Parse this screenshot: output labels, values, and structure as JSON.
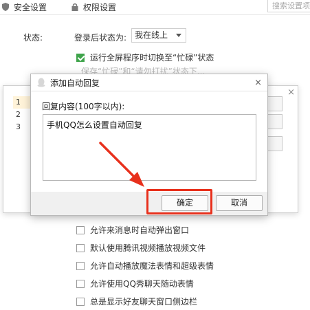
{
  "topbar": {
    "tabs": [
      {
        "label": "安全设置",
        "icon": "shield-icon"
      },
      {
        "label": "权限设置",
        "icon": "lock-icon"
      }
    ],
    "search_placeholder": "搜索设置项"
  },
  "settings": {
    "status_label": "状态:",
    "login_status_label": "登录后状态为:",
    "login_status_value": "我在线上",
    "fullscreen_busy": "运行全屏程序时切换至“忙碌”状态",
    "faded_text": "保存“忙碌”和“请勿打扰”状态下...",
    "checkboxes": [
      {
        "label": "允许来消息时自动弹出窗口",
        "checked": false
      },
      {
        "label": "默认使用腾讯视频播放视频文件",
        "checked": false
      },
      {
        "label": "允许自动播放魔法表情和超级表情",
        "checked": false
      },
      {
        "label": "允许使用QQ秀聊天随动表情",
        "checked": false
      },
      {
        "label": "总是显示好友聊天窗口侧边栏",
        "checked": false
      }
    ]
  },
  "list_dialog": {
    "items": [
      "1",
      "2",
      "3"
    ],
    "close_glyph": "×"
  },
  "dialog": {
    "title": "添加自动回复",
    "close_glyph": "×",
    "content_label": "回复内容(100字以内):",
    "content_value": "手机QQ怎么设置自动回复",
    "ok_label": "确定",
    "cancel_label": "取消"
  },
  "colors": {
    "accent_green": "#3fa44b",
    "highlight_red": "#e8301c"
  }
}
